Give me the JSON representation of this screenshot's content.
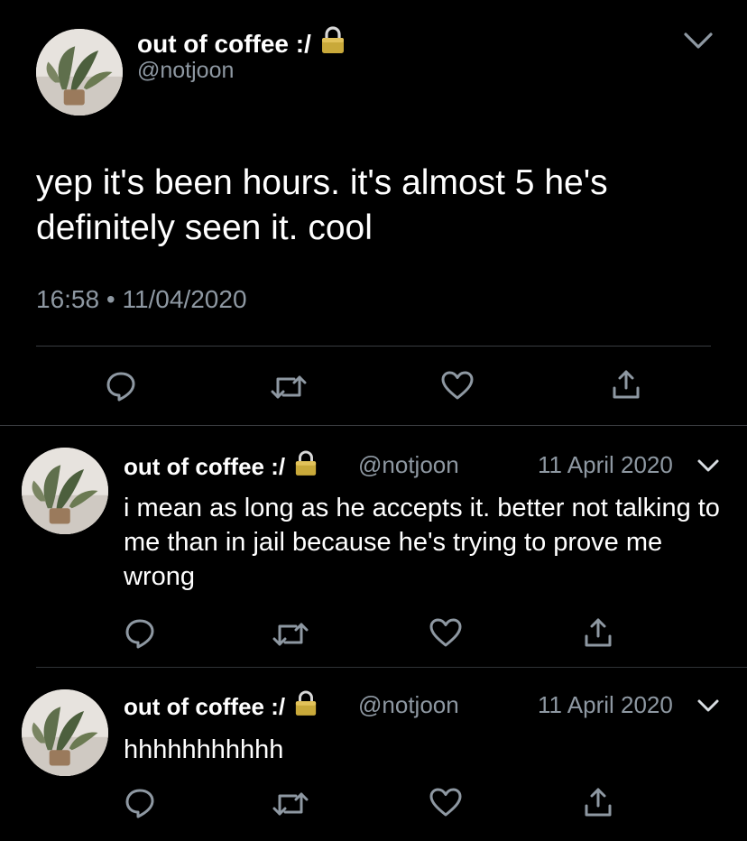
{
  "main_tweet": {
    "display_name": "out of coffee :/",
    "handle": "@notjoon",
    "text": "yep it's been hours. it's almost 5 he's definitely seen it. cool",
    "time": "16:58",
    "separator": "•",
    "date": "11/04/2020",
    "icons": {
      "lock": "lock-icon",
      "menu": "chevron-down-icon",
      "reply": "reply-icon",
      "retweet": "retweet-icon",
      "like": "heart-icon",
      "share": "share-icon"
    }
  },
  "replies": [
    {
      "display_name": "out of coffee :/",
      "handle": "@notjoon",
      "date": "11 April 2020",
      "text": "i mean as long as he accepts it. better not talking to me than in jail because he's trying to prove me wrong"
    },
    {
      "display_name": "out of coffee :/",
      "handle": "@notjoon",
      "date": "11 April 2020",
      "text": "hhhhhhhhhhh"
    }
  ],
  "colors": {
    "background": "#000000",
    "text_primary": "#ffffff",
    "text_secondary": "#8e98a2",
    "icon": "#8e98a2",
    "divider": "#3a3d41",
    "lock": "#c9a93a"
  }
}
